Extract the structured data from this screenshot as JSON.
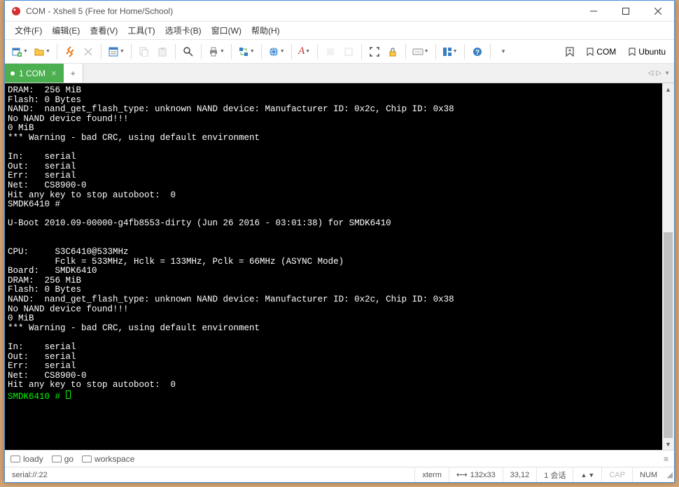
{
  "titlebar": {
    "title": "COM - Xshell 5 (Free for Home/School)"
  },
  "menu": {
    "file": "文件(F)",
    "edit": "编辑(E)",
    "view": "查看(V)",
    "tools": "工具(T)",
    "options": "选项卡(B)",
    "window": "窗口(W)",
    "help": "帮助(H)"
  },
  "bookmarks": {
    "com": "COM",
    "ubuntu": "Ubuntu"
  },
  "tabs": {
    "active": "1 COM"
  },
  "terminal": {
    "lines": [
      "DRAM:  256 MiB",
      "Flash: 0 Bytes",
      "NAND:  nand_get_flash_type: unknown NAND device: Manufacturer ID: 0x2c, Chip ID: 0x38",
      "No NAND device found!!!",
      "0 MiB",
      "*** Warning - bad CRC, using default environment",
      "",
      "In:    serial",
      "Out:   serial",
      "Err:   serial",
      "Net:   CS8900-0",
      "Hit any key to stop autoboot:  0 ",
      "SMDK6410 # ",
      "",
      "U-Boot 2010.09-00000-g4fb8553-dirty (Jun 26 2016 - 03:01:38) for SMDK6410",
      "",
      "",
      "CPU:     S3C6410@533MHz",
      "         Fclk = 533MHz, Hclk = 133MHz, Pclk = 66MHz (ASYNC Mode) ",
      "Board:   SMDK6410",
      "DRAM:  256 MiB",
      "Flash: 0 Bytes",
      "NAND:  nand_get_flash_type: unknown NAND device: Manufacturer ID: 0x2c, Chip ID: 0x38",
      "No NAND device found!!!",
      "0 MiB",
      "*** Warning - bad CRC, using default environment",
      "",
      "In:    serial",
      "Out:   serial",
      "Err:   serial",
      "Net:   CS8900-0",
      "Hit any key to stop autoboot:  0 "
    ],
    "prompt": "SMDK6410 # "
  },
  "quickbar": {
    "loady": "loady",
    "go": "go",
    "workspace": "workspace"
  },
  "status": {
    "conn": "serial://:22",
    "term": "xterm",
    "size": "132x33",
    "pos": "33,12",
    "sessions": "1 会话",
    "cap": "CAP",
    "num": "NUM"
  }
}
